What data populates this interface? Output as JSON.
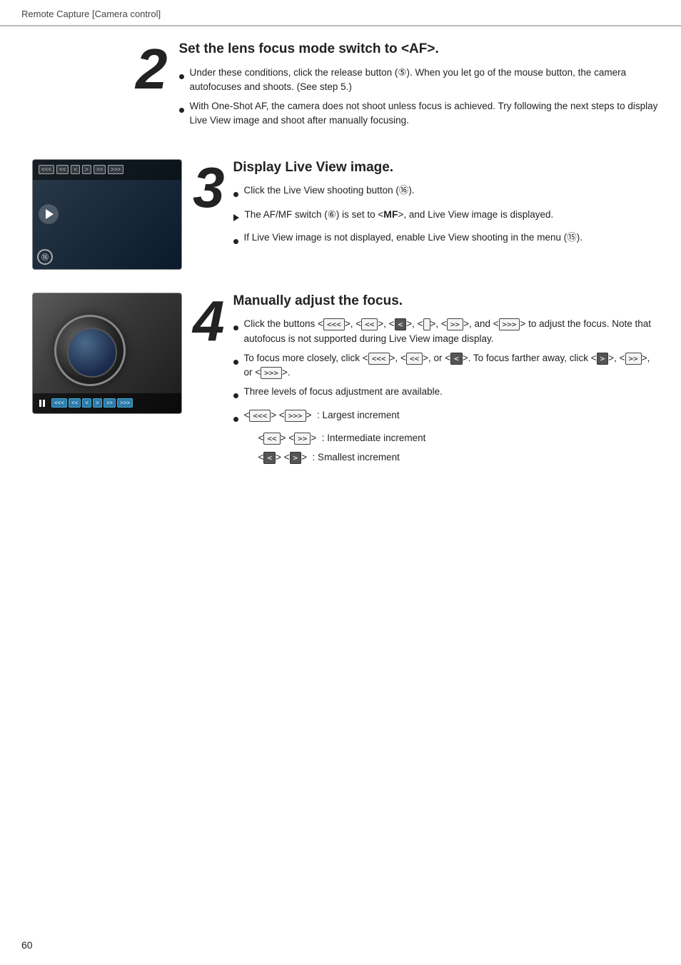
{
  "header": {
    "text": "Remote Capture [Camera control]"
  },
  "step2": {
    "number": "2",
    "title": "Set the lens focus mode switch to <AF>.",
    "bullets": [
      {
        "type": "circle",
        "text": "Under these conditions, click the release button (⑤). When you let go of the mouse button, the camera autofocuses and shoots. (See step 5.)"
      },
      {
        "type": "circle",
        "text": "With One-Shot AF, the camera does not shoot unless focus is achieved. Try following the next steps to display Live View image and shoot after manually focusing."
      }
    ]
  },
  "step3": {
    "number": "3",
    "title": "Display Live View image.",
    "bullets": [
      {
        "type": "circle",
        "text": "Click the Live View shooting button (⑯)."
      },
      {
        "type": "arrow",
        "text": "The AF/MF switch (⑥) is set to <MF>, and Live View image is displayed."
      },
      {
        "type": "circle",
        "text": "If Live View image is not displayed, enable Live View shooting in the menu (⑮)."
      }
    ]
  },
  "step4": {
    "number": "4",
    "title": "Manually adjust the focus.",
    "bullets": [
      {
        "type": "circle",
        "text_parts": [
          "Click the buttons < <<<  >, < <<  >, < <  >, < >  >,",
          "< >>  >, and < >>>  > to adjust the focus. Note that autofocus is not supported during Live View image display."
        ]
      },
      {
        "type": "circle",
        "text_parts": [
          "To focus more closely, click < <<<  >, < <<  >, or",
          "< <  >. To focus farther away, click < >  >,",
          "< >>  >, or < >>>  >."
        ]
      },
      {
        "type": "circle",
        "text": "Three levels of focus adjustment are available."
      },
      {
        "type": "circle",
        "text": "< <<< > < >>> >  : Largest increment"
      },
      {
        "type": "sub",
        "text": "< << > < >> >  : Intermediate increment"
      },
      {
        "type": "sub",
        "text": "< < > < > >  : Smallest increment"
      }
    ]
  },
  "footer": {
    "page_number": "60"
  },
  "ui": {
    "btn_labels": {
      "lll": "<<<",
      "ll": "<<",
      "l": "<",
      "r": ">",
      "rr": ">>",
      "rrr": ">>>"
    }
  }
}
